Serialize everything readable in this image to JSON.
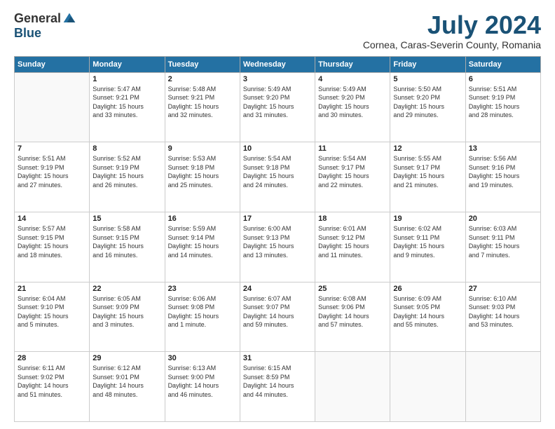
{
  "logo": {
    "general": "General",
    "blue": "Blue"
  },
  "title": "July 2024",
  "subtitle": "Cornea, Caras-Severin County, Romania",
  "days": [
    "Sunday",
    "Monday",
    "Tuesday",
    "Wednesday",
    "Thursday",
    "Friday",
    "Saturday"
  ],
  "weeks": [
    [
      {
        "date": "",
        "info": ""
      },
      {
        "date": "1",
        "info": "Sunrise: 5:47 AM\nSunset: 9:21 PM\nDaylight: 15 hours\nand 33 minutes."
      },
      {
        "date": "2",
        "info": "Sunrise: 5:48 AM\nSunset: 9:21 PM\nDaylight: 15 hours\nand 32 minutes."
      },
      {
        "date": "3",
        "info": "Sunrise: 5:49 AM\nSunset: 9:20 PM\nDaylight: 15 hours\nand 31 minutes."
      },
      {
        "date": "4",
        "info": "Sunrise: 5:49 AM\nSunset: 9:20 PM\nDaylight: 15 hours\nand 30 minutes."
      },
      {
        "date": "5",
        "info": "Sunrise: 5:50 AM\nSunset: 9:20 PM\nDaylight: 15 hours\nand 29 minutes."
      },
      {
        "date": "6",
        "info": "Sunrise: 5:51 AM\nSunset: 9:19 PM\nDaylight: 15 hours\nand 28 minutes."
      }
    ],
    [
      {
        "date": "7",
        "info": "Sunrise: 5:51 AM\nSunset: 9:19 PM\nDaylight: 15 hours\nand 27 minutes."
      },
      {
        "date": "8",
        "info": "Sunrise: 5:52 AM\nSunset: 9:19 PM\nDaylight: 15 hours\nand 26 minutes."
      },
      {
        "date": "9",
        "info": "Sunrise: 5:53 AM\nSunset: 9:18 PM\nDaylight: 15 hours\nand 25 minutes."
      },
      {
        "date": "10",
        "info": "Sunrise: 5:54 AM\nSunset: 9:18 PM\nDaylight: 15 hours\nand 24 minutes."
      },
      {
        "date": "11",
        "info": "Sunrise: 5:54 AM\nSunset: 9:17 PM\nDaylight: 15 hours\nand 22 minutes."
      },
      {
        "date": "12",
        "info": "Sunrise: 5:55 AM\nSunset: 9:17 PM\nDaylight: 15 hours\nand 21 minutes."
      },
      {
        "date": "13",
        "info": "Sunrise: 5:56 AM\nSunset: 9:16 PM\nDaylight: 15 hours\nand 19 minutes."
      }
    ],
    [
      {
        "date": "14",
        "info": "Sunrise: 5:57 AM\nSunset: 9:15 PM\nDaylight: 15 hours\nand 18 minutes."
      },
      {
        "date": "15",
        "info": "Sunrise: 5:58 AM\nSunset: 9:15 PM\nDaylight: 15 hours\nand 16 minutes."
      },
      {
        "date": "16",
        "info": "Sunrise: 5:59 AM\nSunset: 9:14 PM\nDaylight: 15 hours\nand 14 minutes."
      },
      {
        "date": "17",
        "info": "Sunrise: 6:00 AM\nSunset: 9:13 PM\nDaylight: 15 hours\nand 13 minutes."
      },
      {
        "date": "18",
        "info": "Sunrise: 6:01 AM\nSunset: 9:12 PM\nDaylight: 15 hours\nand 11 minutes."
      },
      {
        "date": "19",
        "info": "Sunrise: 6:02 AM\nSunset: 9:11 PM\nDaylight: 15 hours\nand 9 minutes."
      },
      {
        "date": "20",
        "info": "Sunrise: 6:03 AM\nSunset: 9:11 PM\nDaylight: 15 hours\nand 7 minutes."
      }
    ],
    [
      {
        "date": "21",
        "info": "Sunrise: 6:04 AM\nSunset: 9:10 PM\nDaylight: 15 hours\nand 5 minutes."
      },
      {
        "date": "22",
        "info": "Sunrise: 6:05 AM\nSunset: 9:09 PM\nDaylight: 15 hours\nand 3 minutes."
      },
      {
        "date": "23",
        "info": "Sunrise: 6:06 AM\nSunset: 9:08 PM\nDaylight: 15 hours\nand 1 minute."
      },
      {
        "date": "24",
        "info": "Sunrise: 6:07 AM\nSunset: 9:07 PM\nDaylight: 14 hours\nand 59 minutes."
      },
      {
        "date": "25",
        "info": "Sunrise: 6:08 AM\nSunset: 9:06 PM\nDaylight: 14 hours\nand 57 minutes."
      },
      {
        "date": "26",
        "info": "Sunrise: 6:09 AM\nSunset: 9:05 PM\nDaylight: 14 hours\nand 55 minutes."
      },
      {
        "date": "27",
        "info": "Sunrise: 6:10 AM\nSunset: 9:03 PM\nDaylight: 14 hours\nand 53 minutes."
      }
    ],
    [
      {
        "date": "28",
        "info": "Sunrise: 6:11 AM\nSunset: 9:02 PM\nDaylight: 14 hours\nand 51 minutes."
      },
      {
        "date": "29",
        "info": "Sunrise: 6:12 AM\nSunset: 9:01 PM\nDaylight: 14 hours\nand 48 minutes."
      },
      {
        "date": "30",
        "info": "Sunrise: 6:13 AM\nSunset: 9:00 PM\nDaylight: 14 hours\nand 46 minutes."
      },
      {
        "date": "31",
        "info": "Sunrise: 6:15 AM\nSunset: 8:59 PM\nDaylight: 14 hours\nand 44 minutes."
      },
      {
        "date": "",
        "info": ""
      },
      {
        "date": "",
        "info": ""
      },
      {
        "date": "",
        "info": ""
      }
    ]
  ]
}
